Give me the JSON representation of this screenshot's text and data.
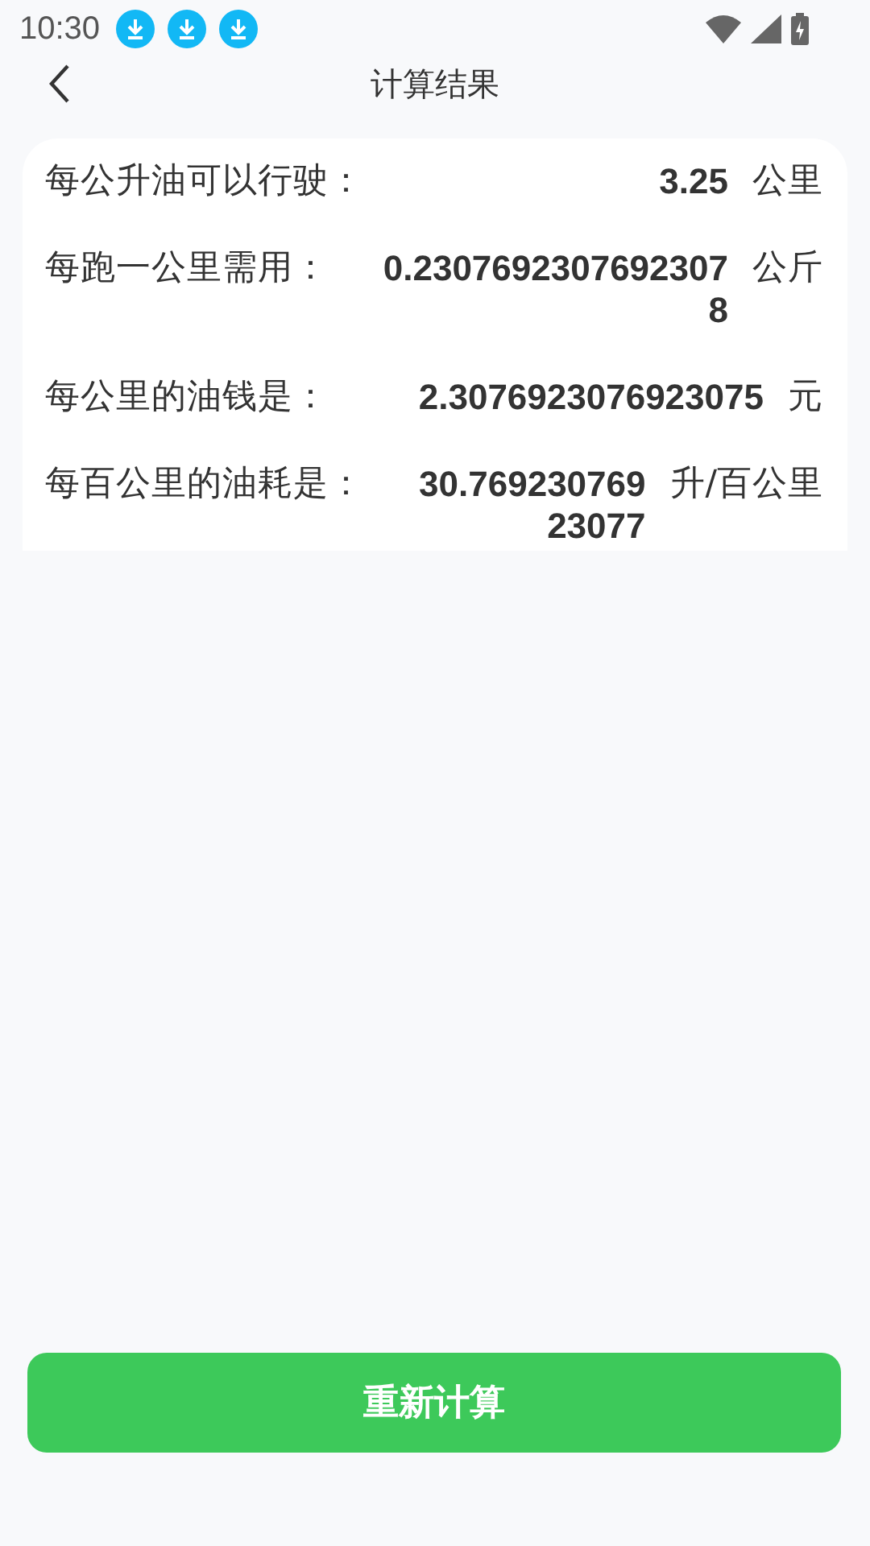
{
  "status_bar": {
    "time": "10:30",
    "notifications": [
      {
        "kind": "download"
      },
      {
        "kind": "download"
      },
      {
        "kind": "download"
      }
    ]
  },
  "header": {
    "title": "计算结果"
  },
  "results": [
    {
      "label": "每公升油可以行驶：",
      "value": "3.25",
      "unit": "公里"
    },
    {
      "label": "每跑一公里需用：",
      "value": "0.23076923076923078",
      "unit": "公斤"
    },
    {
      "label": "每公里的油钱是：",
      "value": "2.3076923076923075",
      "unit": "元"
    },
    {
      "label": "每百公里的油耗是：",
      "value": "30.76923076923077",
      "unit": "升/百公里"
    }
  ],
  "button": {
    "label": "重新计算"
  }
}
